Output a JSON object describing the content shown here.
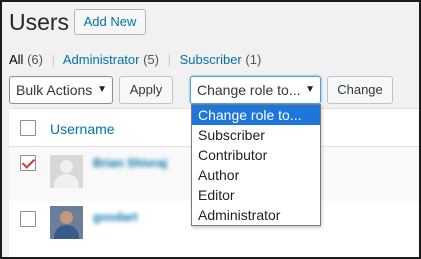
{
  "header": {
    "title": "Users",
    "add_new": "Add New"
  },
  "views": {
    "all_label": "All",
    "all_count": "(6)",
    "admin_label": "Administrator",
    "admin_count": "(5)",
    "sub_label": "Subscriber",
    "sub_count": "(1)",
    "separator": "|"
  },
  "toolbar": {
    "bulk_actions": "Bulk Actions",
    "apply": "Apply",
    "change_role": "Change role to...",
    "change": "Change"
  },
  "dropdown": {
    "options": [
      "Change role to...",
      "Subscriber",
      "Contributor",
      "Author",
      "Editor",
      "Administrator"
    ],
    "selected_index": 0
  },
  "table": {
    "username_header": "Username",
    "rows": [
      {
        "username": "Brian Shivraj",
        "checked": true
      },
      {
        "username": "goodart",
        "checked": false
      }
    ]
  },
  "colors": {
    "link": "#0073aa",
    "highlight": "#1e76d8",
    "check": "#d63638"
  }
}
